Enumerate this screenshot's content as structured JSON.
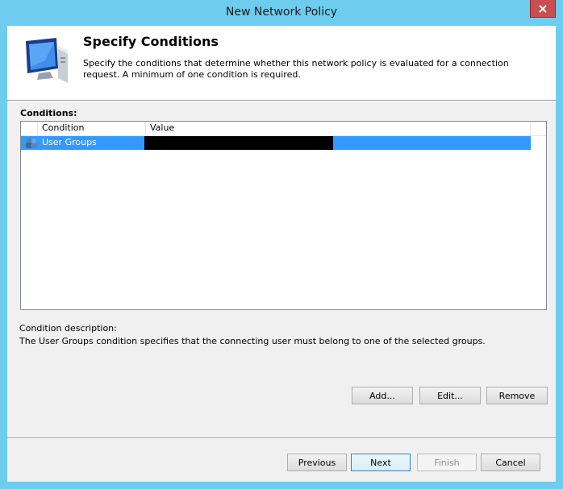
{
  "window": {
    "title": "New Network Policy"
  },
  "header": {
    "title": "Specify Conditions",
    "description": "Specify the conditions that determine whether this network policy is evaluated for a connection request. A minimum of one condition is required."
  },
  "conditions": {
    "label": "Conditions:",
    "columns": [
      "Condition",
      "Value"
    ],
    "rows": [
      {
        "condition": "User Groups",
        "value": ""
      }
    ]
  },
  "description": {
    "label": "Condition description:",
    "text": "The User Groups condition specifies that the connecting user must belong to one of the selected groups."
  },
  "actions": {
    "add": "Add...",
    "edit": "Edit...",
    "remove": "Remove"
  },
  "footer": {
    "previous": "Previous",
    "next": "Next",
    "finish": "Finish",
    "cancel": "Cancel"
  },
  "colors": {
    "frame": "#6ecdef",
    "selection": "#3399ff",
    "close": "#c74f4f"
  },
  "icons": [
    "monitor-icon",
    "user-group-icon",
    "close-icon"
  ]
}
